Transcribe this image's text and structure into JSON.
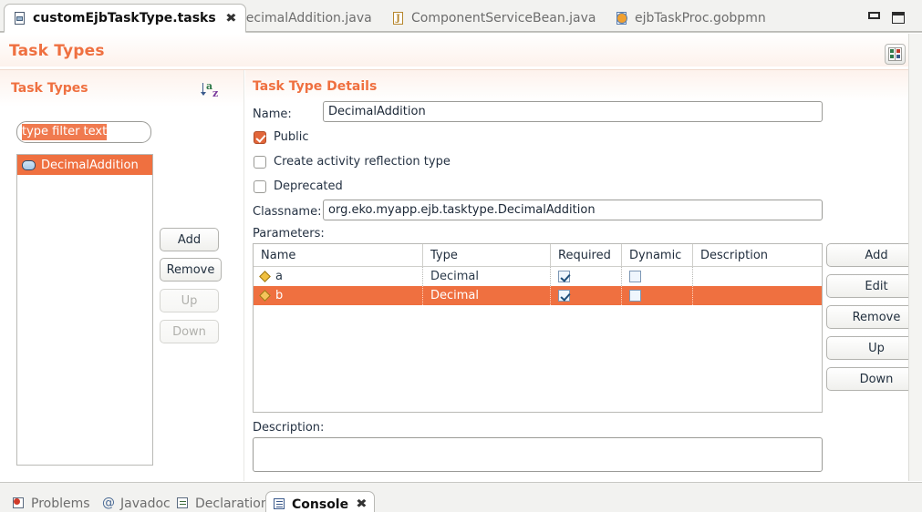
{
  "theme": {
    "accent": "#ef7040",
    "selection_bg": "#ef7040",
    "selection_fg": "#ffffff",
    "checkbox_on": "#e2663a",
    "panel_bg": "#ffffff",
    "chrome_bg": "#f2f2f0"
  },
  "editor_tabs": [
    {
      "label": "customEjbTaskType.tasks",
      "icon": "tasks-file-icon",
      "active": true,
      "closable": true
    },
    {
      "label": "DecimalAddition.java",
      "icon": "java-file-warning-icon",
      "active": false,
      "closable": false
    },
    {
      "label": "ComponentServiceBean.java",
      "icon": "java-file-icon",
      "active": false,
      "closable": false
    },
    {
      "label": "ejbTaskProc.gobpmn",
      "icon": "gobpmn-file-icon",
      "active": false,
      "closable": false
    }
  ],
  "window_controls": {
    "minimize": "minimize-icon",
    "maximize": "maximize-icon"
  },
  "form": {
    "title": "Task Types",
    "toolbar_icons": [
      "layout-columns-icon",
      "layout-columns-icon"
    ]
  },
  "task_types_section": {
    "title": "Task Types",
    "sort_icon": "sort-az-icon",
    "filter": {
      "value": "type filter text",
      "placeholder": "type filter text",
      "selected": true
    },
    "items": [
      {
        "label": "DecimalAddition",
        "icon": "task-type-icon",
        "selected": true
      }
    ],
    "buttons": [
      {
        "label": "Add",
        "enabled": true
      },
      {
        "label": "Remove",
        "enabled": true
      },
      {
        "label": "Up",
        "enabled": false
      },
      {
        "label": "Down",
        "enabled": false
      }
    ]
  },
  "details_section": {
    "title": "Task Type Details",
    "name_label": "Name:",
    "name_value": "DecimalAddition",
    "checkboxes": [
      {
        "label": "Public",
        "checked": true
      },
      {
        "label": "Create activity reflection type",
        "checked": false
      },
      {
        "label": "Deprecated",
        "checked": false
      }
    ],
    "classname_label": "Classname:",
    "classname_value": "org.eko.myapp.ejb.tasktype.DecimalAddition",
    "parameters_label": "Parameters:",
    "parameters_table": {
      "columns": [
        "Name",
        "Type",
        "Required",
        "Dynamic",
        "Description"
      ],
      "rows": [
        {
          "name": "a",
          "type": "Decimal",
          "required": true,
          "dynamic": false,
          "description": "",
          "selected": false,
          "icon": "parameter-icon"
        },
        {
          "name": "b",
          "type": "Decimal",
          "required": true,
          "dynamic": false,
          "description": "",
          "selected": true,
          "icon": "parameter-icon"
        }
      ]
    },
    "parameter_buttons": [
      {
        "label": "Add",
        "enabled": true
      },
      {
        "label": "Edit",
        "enabled": true
      },
      {
        "label": "Remove",
        "enabled": true
      },
      {
        "label": "Up",
        "enabled": true
      },
      {
        "label": "Down",
        "enabled": true
      }
    ],
    "description_label": "Description:",
    "description_value": ""
  },
  "bottom_views": [
    {
      "label": "Problems",
      "icon": "problems-icon",
      "active": false,
      "closable": false
    },
    {
      "label": "Javadoc",
      "icon": "javadoc-icon",
      "active": false,
      "closable": false
    },
    {
      "label": "Declaration",
      "icon": "declaration-icon",
      "active": false,
      "closable": false
    },
    {
      "label": "Console",
      "icon": "console-icon",
      "active": true,
      "closable": true
    }
  ]
}
